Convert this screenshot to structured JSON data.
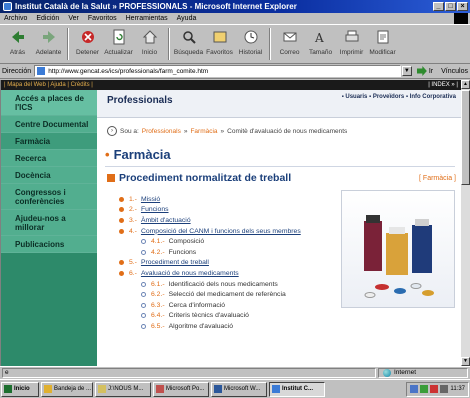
{
  "window": {
    "title": "Institut Català de la Salut » PROFESSIONALS - Microsoft Internet Explorer",
    "buttons": [
      "_",
      "□",
      "×"
    ]
  },
  "menu": [
    "Archivo",
    "Edición",
    "Ver",
    "Favoritos",
    "Herramientas",
    "Ayuda"
  ],
  "toolbar": [
    {
      "label": "Atrás",
      "icon": "back-arrow-icon"
    },
    {
      "label": "Adelante",
      "icon": "forward-arrow-icon"
    },
    {
      "label": "Detener",
      "icon": "stop-icon"
    },
    {
      "label": "Actualizar",
      "icon": "refresh-icon"
    },
    {
      "label": "Inicio",
      "icon": "home-icon"
    },
    {
      "label": "Búsqueda",
      "icon": "search-icon"
    },
    {
      "label": "Favoritos",
      "icon": "favorites-icon"
    },
    {
      "label": "Historial",
      "icon": "history-icon"
    },
    {
      "label": "Correo",
      "icon": "mail-icon"
    },
    {
      "label": "Tamaño",
      "icon": "font-size-icon"
    },
    {
      "label": "Imprimir",
      "icon": "print-icon"
    },
    {
      "label": "Modificar",
      "icon": "edit-icon"
    }
  ],
  "address": {
    "label": "Dirección",
    "url": "http://www.gencat.es/ics/professionals/farm_comite.htm",
    "go": "Ir",
    "links": "Vínculos"
  },
  "topstrip": {
    "left": "| Mapa del Web | Ajuda | Crèdits |",
    "right": "| INDEX » |"
  },
  "sidebar": [
    "Accés a places de l'ICS",
    "Centre Documental",
    "Farmàcia",
    "Recerca",
    "Docència",
    "Congressos i conferències",
    "Ajudeu-nos a millorar",
    "Publicacions"
  ],
  "header": {
    "title": "Professionals",
    "links": "▪ Usuaris  ▪ Proveïdors  ▪ Info Corporativa"
  },
  "breadcrumb": {
    "prefix": "Sou a:",
    "items": [
      "Professionals",
      "Farmàcia"
    ],
    "current": "Comitè d'avaluació de nous medicaments"
  },
  "section_title": "Farmàcia",
  "procedure_title": "Procediment normalitzat de treball",
  "farmacia_link": "[ Farmàcia ]",
  "toc": [
    {
      "level": 1,
      "num": "1.-",
      "text": "Missió"
    },
    {
      "level": 1,
      "num": "2.-",
      "text": "Funcions"
    },
    {
      "level": 1,
      "num": "3.-",
      "text": "Àmbit d'actuació"
    },
    {
      "level": 1,
      "num": "4.-",
      "text": "Composició del CANM i funcions dels seus membres"
    },
    {
      "level": 2,
      "num": "4.1.-",
      "text": "Composició"
    },
    {
      "level": 2,
      "num": "4.2.-",
      "text": "Funcions"
    },
    {
      "level": 1,
      "num": "5.-",
      "text": "Procediment de treball"
    },
    {
      "level": 1,
      "num": "6.-",
      "text": "Avaluació de nous medicaments"
    },
    {
      "level": 2,
      "num": "6.1.-",
      "text": "Identificació dels nous medicaments"
    },
    {
      "level": 2,
      "num": "6.2.-",
      "text": "Selecció del medicament de referència"
    },
    {
      "level": 2,
      "num": "6.3.-",
      "text": "Cerca d'informació"
    },
    {
      "level": 2,
      "num": "6.4.-",
      "text": "Criteris tècnics d'avaluació"
    },
    {
      "level": 2,
      "num": "6.5.-",
      "text": "Algoritme d'avaluació"
    }
  ],
  "status": {
    "left": "",
    "zone": "Internet"
  },
  "taskbar": {
    "start": "Inicio",
    "tasks": [
      "Bandeja de ...",
      "J:\\NOUS M...",
      "Microsoft Po...",
      "Microsoft W...",
      "Institut C..."
    ],
    "active_index": 4,
    "clock": "11:37"
  }
}
